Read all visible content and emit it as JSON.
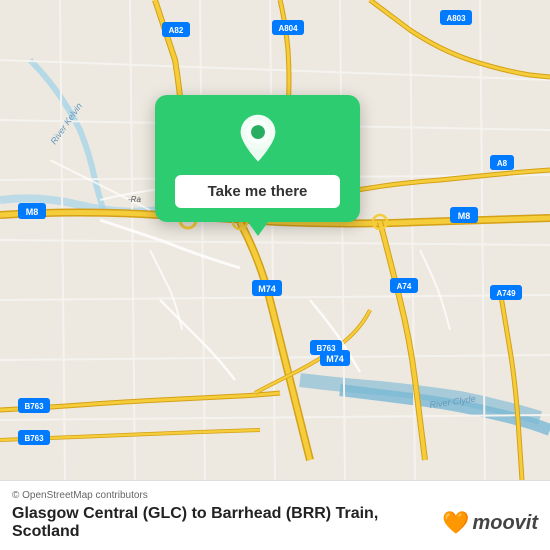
{
  "map": {
    "attribution": "© OpenStreetMap contributors",
    "center_label": "Glasgow Central (GLC) to Barrhead (BRR) Train, Scotland"
  },
  "popup": {
    "button_label": "Take me there"
  },
  "footer": {
    "attribution": "© OpenStreetMap contributors",
    "route_label": "Glasgow Central (GLC) to Barrhead (BRR) Train,",
    "region": "Scotland",
    "moovit_text": "moovit"
  },
  "colors": {
    "map_bg": "#e8e0d8",
    "green": "#27ae60",
    "road_motorway": "#f0c040",
    "road_a": "#f0c040",
    "road_minor": "#ffffff",
    "road_bg": "#ccc",
    "water": "#9ecae1"
  }
}
